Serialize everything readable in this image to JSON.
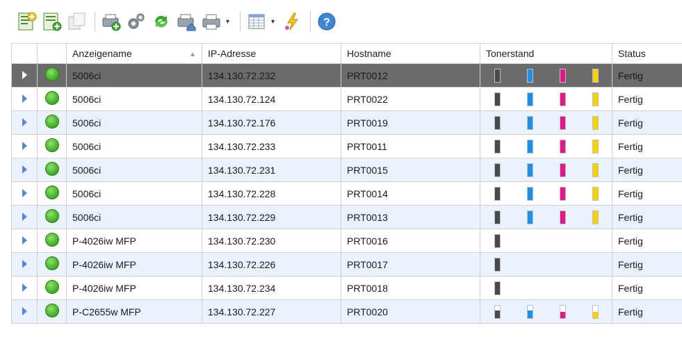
{
  "toolbar": {
    "icons": [
      "add-device-icon",
      "add-list-icon",
      "copy-disabled-icon",
      "printer-add-icon",
      "settings-gears-icon",
      "refresh-icon",
      "printer-home-icon",
      "printer-icon",
      "view-columns-icon",
      "lightning-icon",
      "help-icon"
    ]
  },
  "table": {
    "headers": {
      "name": "Anzeigename",
      "ip": "IP-Adresse",
      "host": "Hostname",
      "toner": "Tonerstand",
      "status": "Status"
    },
    "colors": {
      "black": "#4a4a4a",
      "cyan": "#1e90e8",
      "magenta": "#e0188c",
      "yellow": "#f5d300"
    },
    "rows": [
      {
        "name": "5006ci",
        "ip": "134.130.72.232",
        "host": "PRT0012",
        "status": "Fertig",
        "selected": true,
        "toner": {
          "black": 1,
          "cyan": 1,
          "magenta": 1,
          "yellow": 1
        }
      },
      {
        "name": "5006ci",
        "ip": "134.130.72.124",
        "host": "PRT0022",
        "status": "Fertig",
        "toner": {
          "black": 1,
          "cyan": 1,
          "magenta": 1,
          "yellow": 1
        }
      },
      {
        "name": "5006ci",
        "ip": "134.130.72.176",
        "host": "PRT0019",
        "status": "Fertig",
        "toner": {
          "black": 1,
          "cyan": 1,
          "magenta": 1,
          "yellow": 1
        }
      },
      {
        "name": "5006ci",
        "ip": "134.130.72.233",
        "host": "PRT0011",
        "status": "Fertig",
        "toner": {
          "black": 1,
          "cyan": 1,
          "magenta": 1,
          "yellow": 1
        }
      },
      {
        "name": "5006ci",
        "ip": "134.130.72.231",
        "host": "PRT0015",
        "status": "Fertig",
        "toner": {
          "black": 1,
          "cyan": 1,
          "magenta": 1,
          "yellow": 1
        }
      },
      {
        "name": "5006ci",
        "ip": "134.130.72.228",
        "host": "PRT0014",
        "status": "Fertig",
        "toner": {
          "black": 1,
          "cyan": 1,
          "magenta": 1,
          "yellow": 1
        }
      },
      {
        "name": "5006ci",
        "ip": "134.130.72.229",
        "host": "PRT0013",
        "status": "Fertig",
        "toner": {
          "black": 1,
          "cyan": 1,
          "magenta": 1,
          "yellow": 1
        }
      },
      {
        "name": "P-4026iw MFP",
        "ip": "134.130.72.230",
        "host": "PRT0016",
        "status": "Fertig",
        "toner": {
          "black": 1
        }
      },
      {
        "name": "P-4026iw MFP",
        "ip": "134.130.72.226",
        "host": "PRT0017",
        "status": "Fertig",
        "toner": {
          "black": 1
        }
      },
      {
        "name": "P-4026iw MFP",
        "ip": "134.130.72.234",
        "host": "PRT0018",
        "status": "Fertig",
        "toner": {
          "black": 1
        }
      },
      {
        "name": "P-C2655w MFP",
        "ip": "134.130.72.227",
        "host": "PRT0020",
        "status": "Fertig",
        "toner": {
          "black": 0.6,
          "cyan": 0.6,
          "magenta": 0.5,
          "yellow": 0.5
        }
      }
    ]
  }
}
